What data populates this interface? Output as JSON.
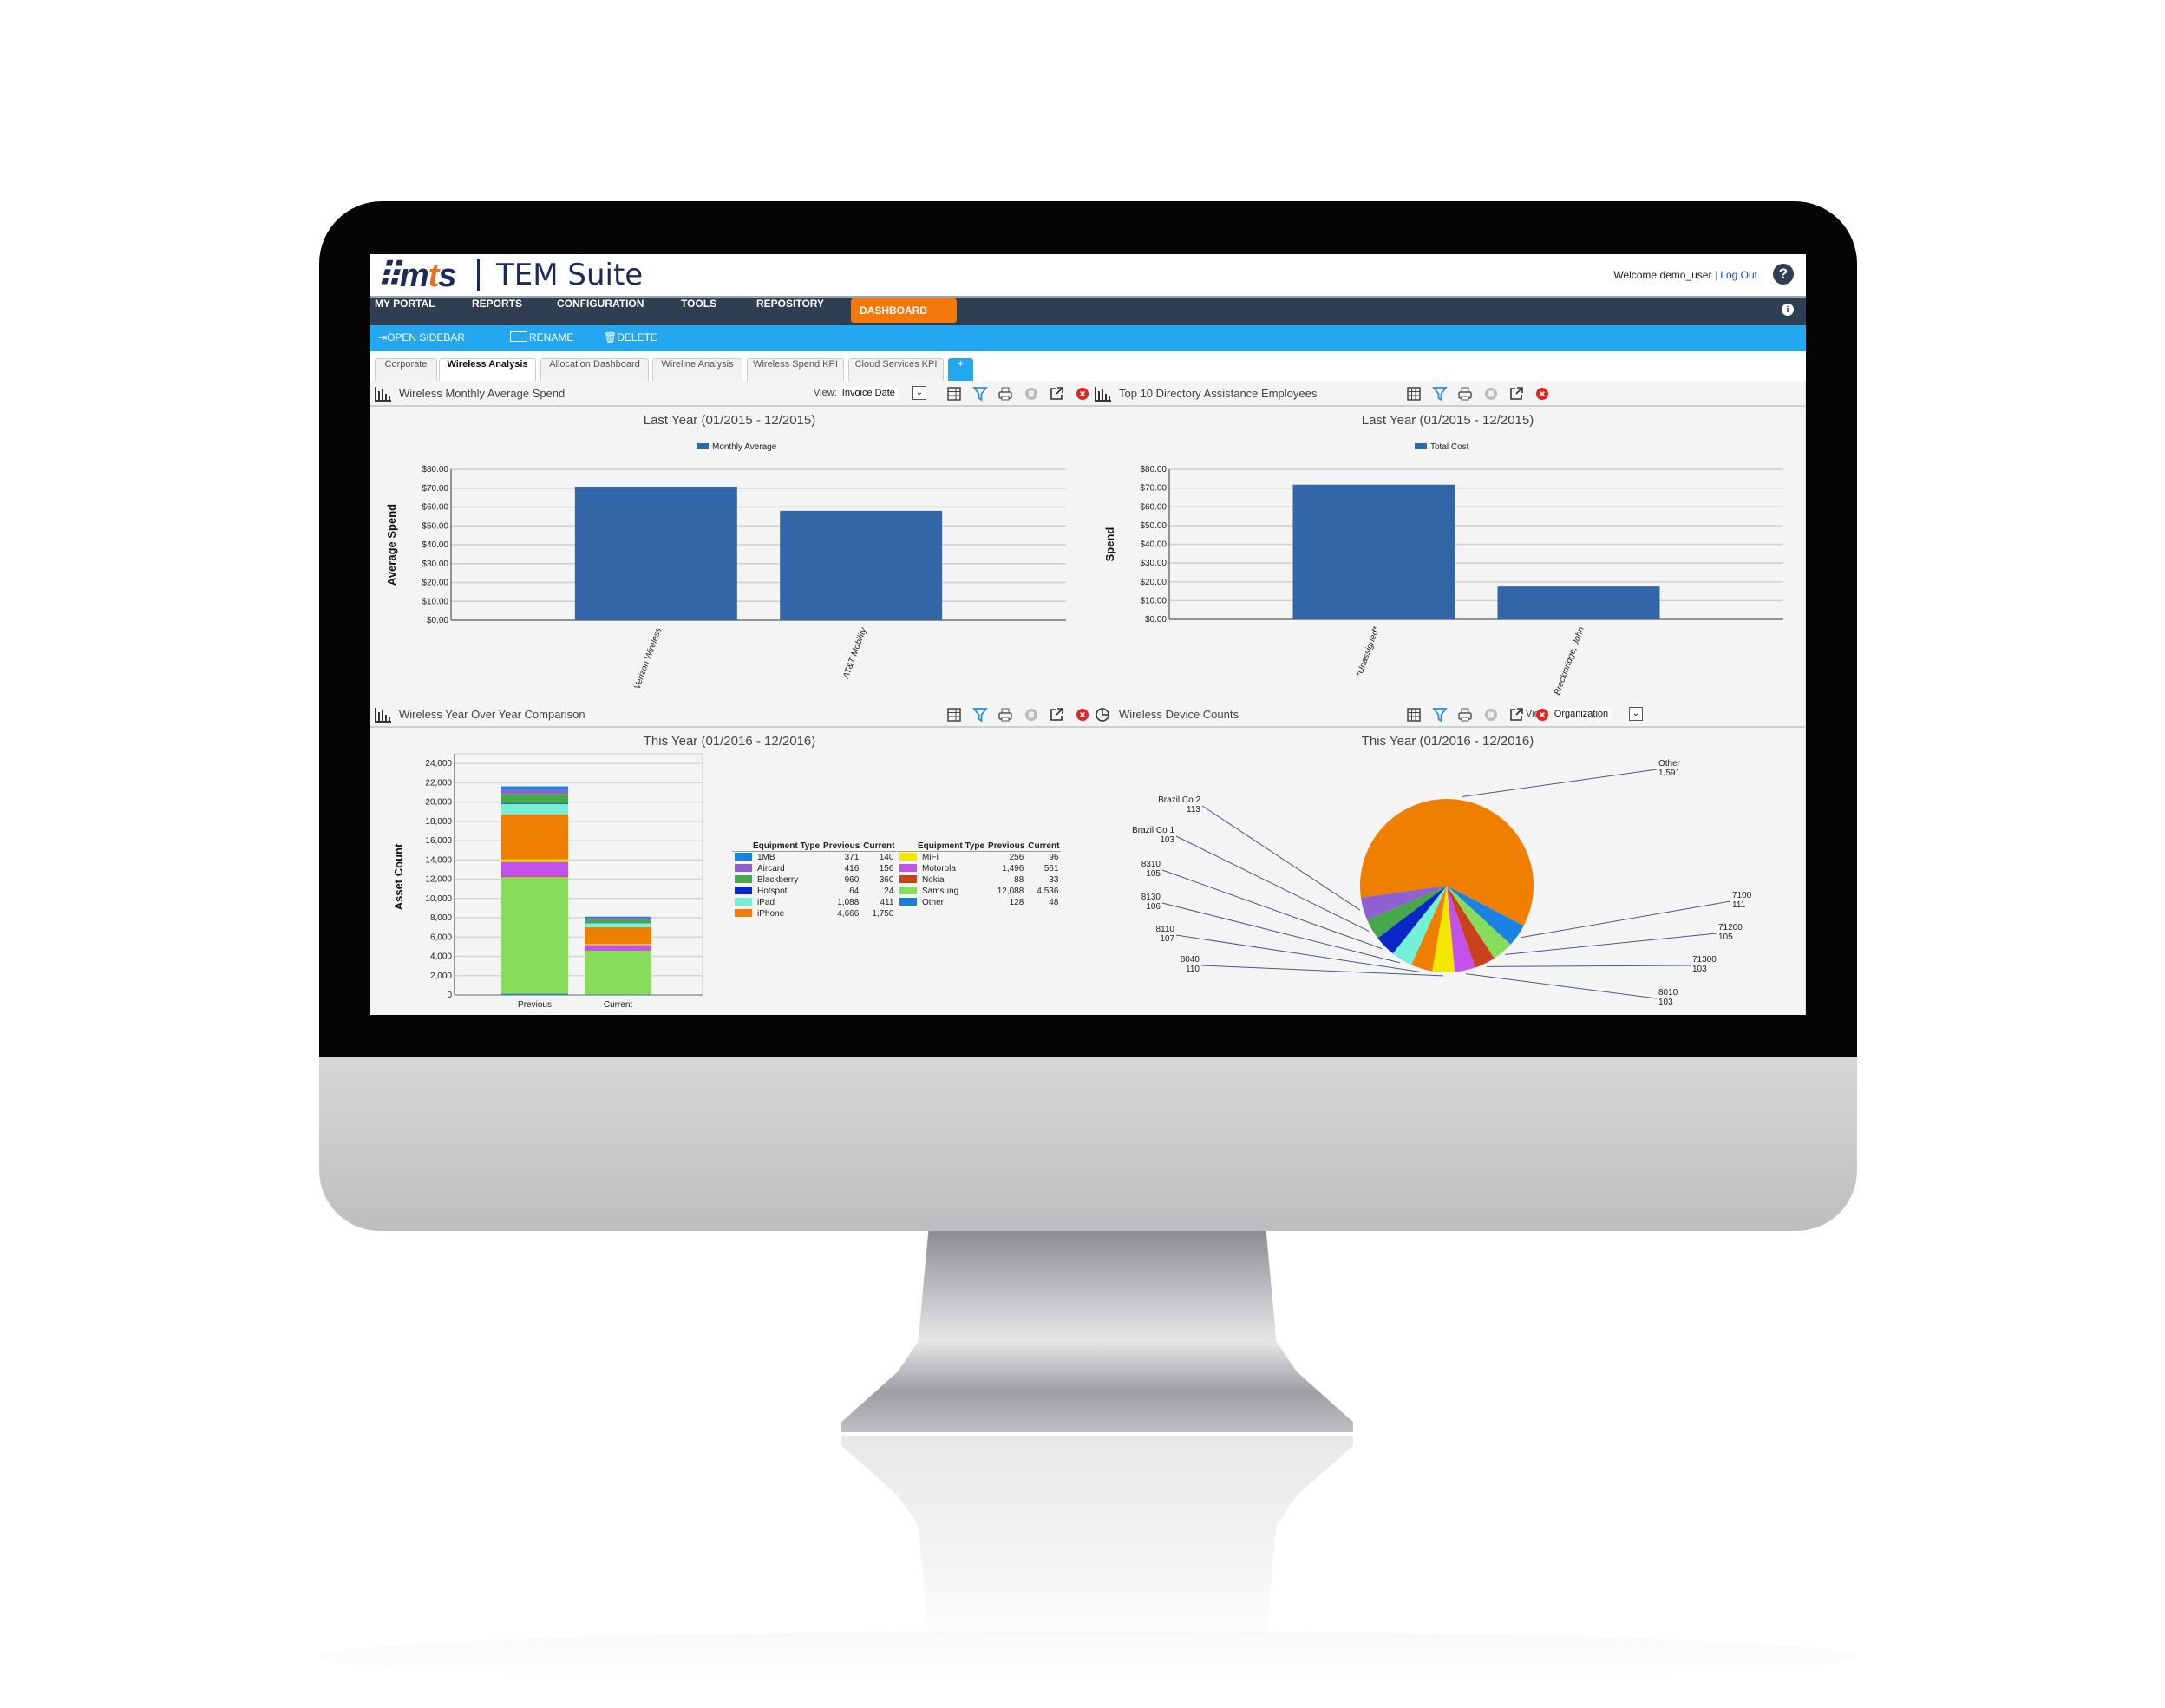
{
  "app": {
    "logo_text": "mts",
    "suite_title": "TEM Suite",
    "welcome": "Welcome demo_user",
    "logout": "Log Out",
    "help": "?",
    "info": "i"
  },
  "nav": [
    {
      "label": "MY PORTAL"
    },
    {
      "label": "REPORTS"
    },
    {
      "label": "CONFIGURATION"
    },
    {
      "label": "TOOLS"
    },
    {
      "label": "REPOSITORY"
    },
    {
      "label": "DASHBOARD",
      "active": true
    }
  ],
  "toolbar": {
    "open_sidebar": "OPEN SIDEBAR",
    "rename": "RENAME",
    "delete": "DELETE"
  },
  "tabs": [
    {
      "label": "Corporate"
    },
    {
      "label": "Wireless Analysis",
      "active": true
    },
    {
      "label": "Allocation Dashboard"
    },
    {
      "label": "Wireline Analysis"
    },
    {
      "label": "Wireless Spend KPI"
    },
    {
      "label": "Cloud Services KPI"
    }
  ],
  "add_tab": "+",
  "colors": {
    "nav_bg": "#2f3e50",
    "toolbar_bg": "#22a7f0",
    "active_nav": "#f5780a",
    "bar": "#3366a6"
  },
  "panels": {
    "monthly": {
      "title": "Wireless Monthly Average Spend",
      "view_label": "View:",
      "view_value": "Invoice Date"
    },
    "top10": {
      "title": "Top 10 Directory Assistance Employees"
    },
    "yoy": {
      "title": "Wireless Year Over Year Comparison"
    },
    "devices": {
      "title": "Wireless Device Counts",
      "view_label": "View:",
      "view_value": "Organization"
    }
  },
  "chart_data": [
    {
      "type": "bar",
      "title": "Last Year (01/2015 - 12/2015)",
      "legend": [
        "Monthly Average"
      ],
      "ylabel": "Average Spend",
      "xlabel": "",
      "categories": [
        "Verizon Wireless",
        "AT&T Mobility"
      ],
      "values": [
        70.8,
        58.0
      ],
      "ylim": [
        0,
        80
      ],
      "yticks": [
        "$0.00",
        "$10.00",
        "$20.00",
        "$30.00",
        "$40.00",
        "$50.00",
        "$60.00",
        "$70.00",
        "$80.00"
      ],
      "grid": true,
      "legend_position": "top"
    },
    {
      "type": "bar",
      "title": "Last Year (01/2015 - 12/2015)",
      "legend": [
        "Total Cost"
      ],
      "ylabel": "Spend",
      "xlabel": "",
      "categories": [
        "*Unassigned*",
        "Breckinridge, John"
      ],
      "values": [
        71.8,
        17.5
      ],
      "ylim": [
        0,
        80
      ],
      "yticks": [
        "$0.00",
        "$10.00",
        "$20.00",
        "$30.00",
        "$40.00",
        "$50.00",
        "$60.00",
        "$70.00",
        "$80.00"
      ],
      "grid": true,
      "legend_position": "top"
    },
    {
      "type": "bar",
      "stacked": true,
      "title": "This Year (01/2016 - 12/2016)",
      "ylabel": "Asset Count",
      "xlabel": "",
      "categories": [
        "Previous",
        "Current"
      ],
      "ylim": [
        0,
        25000
      ],
      "yticks": [
        "0",
        "2,000",
        "4,000",
        "6,000",
        "8,000",
        "10,000",
        "12,000",
        "14,000",
        "16,000",
        "18,000",
        "20,000",
        "22,000",
        "24,000"
      ],
      "grid": true,
      "table_headers": [
        "Equipment Type",
        "Previous",
        "Current"
      ],
      "series": [
        {
          "name": "1MB",
          "values": [
            371,
            140
          ],
          "prev": "371",
          "cur": "140",
          "color": "#1a82e2"
        },
        {
          "name": "Aircard",
          "values": [
            416,
            156
          ],
          "prev": "416",
          "cur": "156",
          "color": "#9060d0"
        },
        {
          "name": "Blackberry",
          "values": [
            960,
            360
          ],
          "prev": "960",
          "cur": "360",
          "color": "#46a84a"
        },
        {
          "name": "Hotspot",
          "values": [
            64,
            24
          ],
          "prev": "64",
          "cur": "24",
          "color": "#0a28c8"
        },
        {
          "name": "iPad",
          "values": [
            1088,
            411
          ],
          "prev": "1,088",
          "cur": "411",
          "color": "#74f0d6"
        },
        {
          "name": "iPhone",
          "values": [
            4666,
            1750
          ],
          "prev": "4,666",
          "cur": "1,750",
          "color": "#ee7f00"
        },
        {
          "name": "MiFi",
          "values": [
            256,
            96
          ],
          "prev": "256",
          "cur": "96",
          "color": "#f5e800"
        },
        {
          "name": "Motorola",
          "values": [
            1496,
            561
          ],
          "prev": "1,496",
          "cur": "561",
          "color": "#c452ea"
        },
        {
          "name": "Nokia",
          "values": [
            88,
            33
          ],
          "prev": "88",
          "cur": "33",
          "color": "#c8411a"
        },
        {
          "name": "Samsung",
          "values": [
            12088,
            4536
          ],
          "prev": "12,088",
          "cur": "4,536",
          "color": "#88dc5c"
        },
        {
          "name": "Other",
          "values": [
            128,
            48
          ],
          "prev": "128",
          "cur": "48",
          "color": "#1f7fd6"
        }
      ]
    },
    {
      "type": "pie",
      "title": "This Year (01/2016 - 12/2016)",
      "slices": [
        {
          "label": "Other",
          "value": 1591,
          "display": "1,591",
          "color": "#ee7f00"
        },
        {
          "label": "7100",
          "value": 111,
          "display": "111",
          "color": "#1a82e2"
        },
        {
          "label": "71200",
          "value": 105,
          "display": "105",
          "color": "#88dc5c"
        },
        {
          "label": "71300",
          "value": 103,
          "display": "103",
          "color": "#c8411a"
        },
        {
          "label": "8010",
          "value": 103,
          "display": "103",
          "color": "#c452ea"
        },
        {
          "label": "8040",
          "value": 110,
          "display": "110",
          "color": "#f5e800"
        },
        {
          "label": "8110",
          "value": 107,
          "display": "107",
          "color": "#ee7f00"
        },
        {
          "label": "8130",
          "value": 106,
          "display": "106",
          "color": "#74f0d6"
        },
        {
          "label": "8310",
          "value": 105,
          "display": "105",
          "color": "#0a28c8"
        },
        {
          "label": "Brazil Co 1",
          "value": 103,
          "display": "103",
          "color": "#46a84a"
        },
        {
          "label": "Brazil Co 2",
          "value": 113,
          "display": "113",
          "color": "#9060d0"
        }
      ]
    }
  ]
}
